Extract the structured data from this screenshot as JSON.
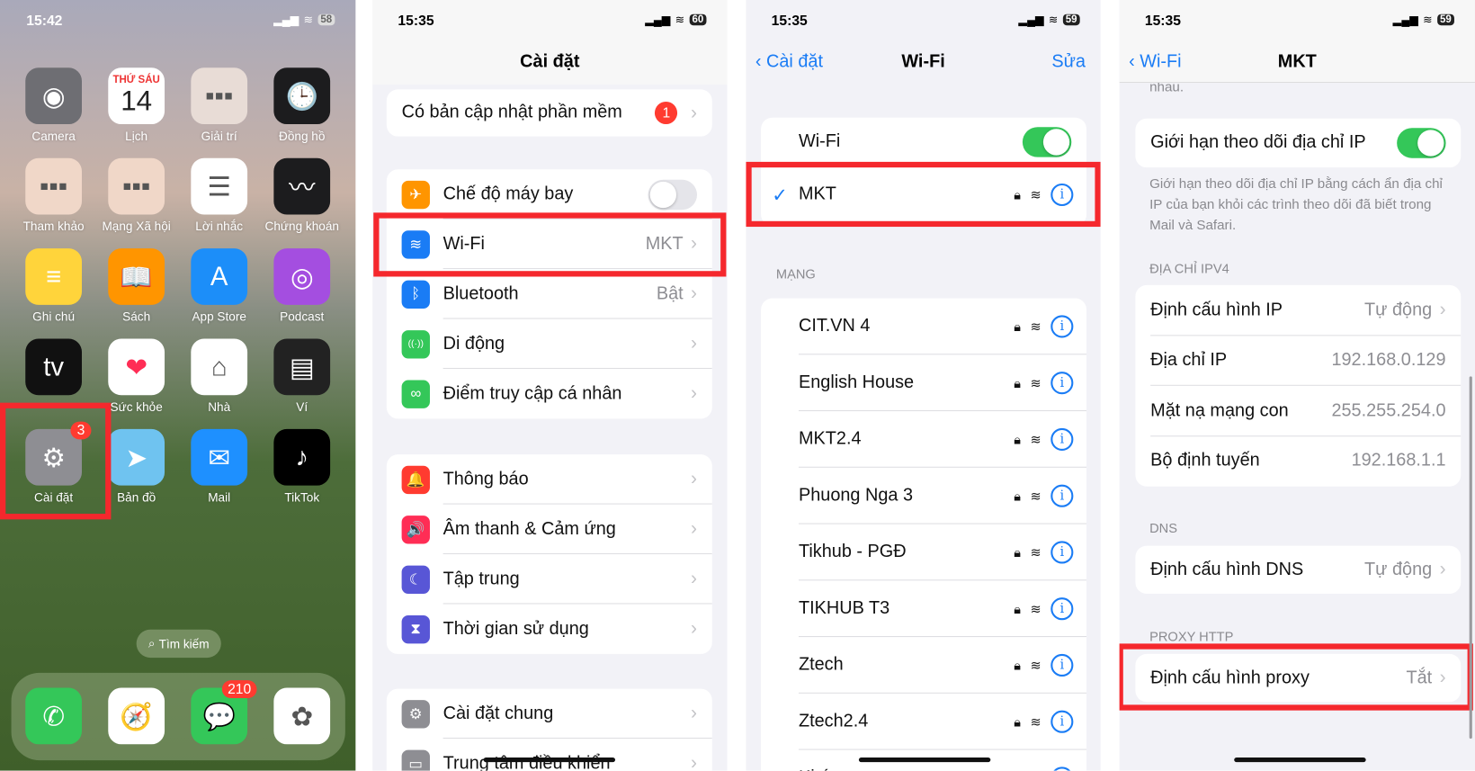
{
  "home": {
    "time": "15:42",
    "battery": "58",
    "search": "Tìm kiếm",
    "apps": [
      {
        "label": "Camera",
        "icon": "camera-icon",
        "color": "#6e6e73",
        "glyph": "◉"
      },
      {
        "label": "Lịch",
        "icon": "calendar-icon",
        "color": "#ffffff",
        "glyph": "14",
        "sub": "THỨ SÁU"
      },
      {
        "label": "Giải trí",
        "icon": "folder-icon",
        "color": "#e8dcd6",
        "glyph": "▪▪▪"
      },
      {
        "label": "Đồng hồ",
        "icon": "clock-icon",
        "color": "#1c1c1e",
        "glyph": "🕒"
      },
      {
        "label": "Tham khảo",
        "icon": "folder-icon",
        "color": "#f0d7c8",
        "glyph": "▪▪▪"
      },
      {
        "label": "Mạng Xã hội",
        "icon": "folder-icon",
        "color": "#f0d7c8",
        "glyph": "▪▪▪"
      },
      {
        "label": "Lời nhắc",
        "icon": "reminders-icon",
        "color": "#ffffff",
        "glyph": "☰"
      },
      {
        "label": "Chứng khoán",
        "icon": "stocks-icon",
        "color": "#1c1c1e",
        "glyph": "〰"
      },
      {
        "label": "Ghi chú",
        "icon": "notes-icon",
        "color": "#ffd43b",
        "glyph": "≡"
      },
      {
        "label": "Sách",
        "icon": "books-icon",
        "color": "#ff9500",
        "glyph": "📖"
      },
      {
        "label": "App Store",
        "icon": "app-store-icon",
        "color": "#1c8ef9",
        "glyph": "A"
      },
      {
        "label": "Podcast",
        "icon": "podcast-icon",
        "color": "#a44ee0",
        "glyph": "◎"
      },
      {
        "label": "",
        "icon": "apple-tv-icon",
        "color": "#111111",
        "glyph": "tv"
      },
      {
        "label": "Sức khỏe",
        "icon": "health-icon",
        "color": "#ffffff",
        "glyph": "❤"
      },
      {
        "label": "Nhà",
        "icon": "home-app-icon",
        "color": "#ffffff",
        "glyph": "⌂"
      },
      {
        "label": "Ví",
        "icon": "wallet-icon",
        "color": "#222222",
        "glyph": "▤"
      },
      {
        "label": "Cài đặt",
        "icon": "settings-gear-icon",
        "color": "#8e8e93",
        "glyph": "⚙",
        "badge": "3"
      },
      {
        "label": "Bản đồ",
        "icon": "maps-icon",
        "color": "#6fc3f0",
        "glyph": "➤"
      },
      {
        "label": "Mail",
        "icon": "mail-icon",
        "color": "#1e90ff",
        "glyph": "✉"
      },
      {
        "label": "TikTok",
        "icon": "tiktok-icon",
        "color": "#000000",
        "glyph": "♪"
      }
    ],
    "dock": [
      {
        "icon": "phone-icon",
        "color": "#34c759",
        "glyph": "✆"
      },
      {
        "icon": "safari-icon",
        "color": "#ffffff",
        "glyph": "🧭"
      },
      {
        "icon": "messages-icon",
        "color": "#34c759",
        "glyph": "💬",
        "badge": "210"
      },
      {
        "icon": "photos-icon",
        "color": "#ffffff",
        "glyph": "✿"
      }
    ]
  },
  "settings": {
    "time": "15:35",
    "battery": "60",
    "title": "Cài đặt",
    "update": {
      "label": "Có bản cập nhật phần mềm",
      "badge": "1"
    },
    "groups": [
      [
        {
          "label": "Chế độ máy bay",
          "icon": "airplane-icon",
          "color": "#ff9500",
          "glyph": "✈",
          "toggle": false
        },
        {
          "label": "Wi-Fi",
          "icon": "wifi-icon",
          "color": "#1a7cf5",
          "glyph": "≋",
          "value": "MKT"
        },
        {
          "label": "Bluetooth",
          "icon": "bluetooth-icon",
          "color": "#1a7cf5",
          "glyph": "ᛒ",
          "value": "Bật"
        },
        {
          "label": "Di động",
          "icon": "cellular-icon",
          "color": "#34c759",
          "glyph": "((·))"
        },
        {
          "label": "Điểm truy cập cá nhân",
          "icon": "hotspot-icon",
          "color": "#34c759",
          "glyph": "∞"
        }
      ],
      [
        {
          "label": "Thông báo",
          "icon": "notification-icon",
          "color": "#ff3b30",
          "glyph": "🔔"
        },
        {
          "label": "Âm thanh & Cảm ứng",
          "icon": "sound-icon",
          "color": "#ff2d55",
          "glyph": "🔊"
        },
        {
          "label": "Tập trung",
          "icon": "moon-icon",
          "color": "#5856d6",
          "glyph": "☾"
        },
        {
          "label": "Thời gian sử dụng",
          "icon": "hourglass-icon",
          "color": "#5856d6",
          "glyph": "⧗"
        }
      ],
      [
        {
          "label": "Cài đặt chung",
          "icon": "gear-icon",
          "color": "#8e8e93",
          "glyph": "⚙"
        },
        {
          "label": "Trung tâm điều khiển",
          "icon": "control-center-icon",
          "color": "#8e8e93",
          "glyph": "▭"
        }
      ]
    ]
  },
  "wifi": {
    "time": "15:35",
    "battery": "59",
    "back": "Cài đặt",
    "title": "Wi-Fi",
    "edit": "Sửa",
    "toggle_label": "Wi-Fi",
    "toggle_on": true,
    "connected": "MKT",
    "section": "MẠNG",
    "networks": [
      "CIT.VN 4",
      "English House",
      "MKT2.4",
      "Phuong Nga 3",
      "Tikhub - PGĐ",
      "TIKHUB T3",
      "Ztech",
      "Ztech2.4",
      "Khác"
    ]
  },
  "detail": {
    "time": "15:35",
    "battery": "59",
    "back": "Wi-Fi",
    "title": "MKT",
    "cut_text": "nhau.",
    "ip_limit": {
      "label": "Giới hạn theo dõi địa chỉ IP",
      "on": true,
      "note": "Giới hạn theo dõi địa chỉ IP bằng cách ẩn địa chỉ IP của bạn khỏi các trình theo dõi đã biết trong Mail và Safari."
    },
    "ipv4_header": "ĐỊA CHỈ IPV4",
    "ipv4": [
      {
        "label": "Định cấu hình IP",
        "value": "Tự động",
        "chev": true
      },
      {
        "label": "Địa chỉ IP",
        "value": "192.168.0.129"
      },
      {
        "label": "Mặt nạ mạng con",
        "value": "255.255.254.0"
      },
      {
        "label": "Bộ định tuyến",
        "value": "192.168.1.1"
      }
    ],
    "dns_header": "DNS",
    "dns": {
      "label": "Định cấu hình DNS",
      "value": "Tự động"
    },
    "proxy_header": "PROXY HTTP",
    "proxy": {
      "label": "Định cấu hình proxy",
      "value": "Tắt"
    }
  },
  "colors": {
    "highlight": "#f5282d",
    "accent": "#1a7cf5",
    "toggle_on": "#34c759"
  }
}
